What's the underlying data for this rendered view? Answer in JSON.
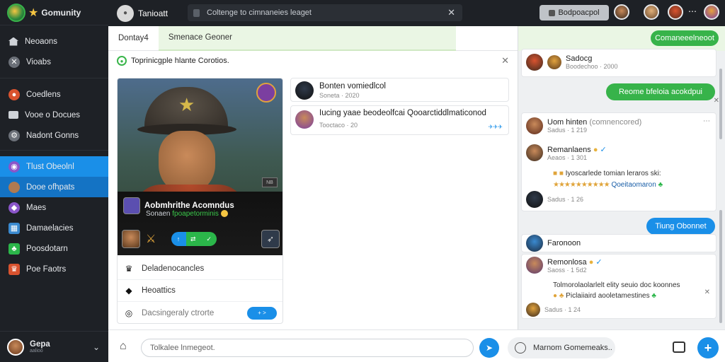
{
  "sidebar": {
    "brand": "Gomunity",
    "nav": [
      {
        "label": "Neoaons",
        "icon": "home-icon",
        "color": "#888888"
      },
      {
        "label": "Vioabs",
        "icon": "game-icon",
        "color": "#888888"
      }
    ],
    "nav2": [
      {
        "label": "Coedlens",
        "icon": "fire-icon",
        "color": "#d9532f"
      },
      {
        "label": "Vooe o Docues",
        "icon": "video-icon",
        "color": "#888888"
      },
      {
        "label": "Nadont Gonns",
        "icon": "gear-icon",
        "color": "#888888"
      }
    ],
    "nav3": [
      {
        "label": "Tlust Obeolnl",
        "icon": "orb-icon",
        "color": "#8a55c9",
        "state": "active"
      },
      {
        "label": "Dooe ofhpats",
        "icon": "avatar-icon",
        "color": "#b07a50",
        "state": "active2"
      },
      {
        "label": "Maes",
        "icon": "shield-icon",
        "color": "#8a55c9"
      },
      {
        "label": "Damaelacies",
        "icon": "puzzle-icon",
        "color": "#3a8ad0"
      },
      {
        "label": "Poosdotarn",
        "icon": "plant-icon",
        "color": "#2bb64a"
      },
      {
        "label": "Poe Faotrs",
        "icon": "trophy-icon",
        "color": "#d9532f"
      }
    ],
    "user": {
      "name": "Gepa",
      "sub": "aalioo"
    }
  },
  "topbar": {
    "title": "Tanioatt",
    "search_placeholder": "Coltenge to cimnaneies leaget",
    "pill_label": "Bodpoacpol",
    "colors": {
      "accent": "#1a8fe8",
      "green": "#37b34a"
    }
  },
  "main": {
    "tabs": [
      "Dontay4",
      "Smenace Geoner"
    ],
    "subheader": "Toprinicgple hlante Corotios.",
    "card": {
      "title": "Aobmhrithe Acomndus",
      "sub_prefix": "Sonaen",
      "sub_green": "fpoapetorminis",
      "mini_badge": "NB",
      "list": [
        {
          "label": "Deladenocancles",
          "icon": "crown-icon"
        },
        {
          "label": "Heoattics",
          "icon": "diamond-icon"
        },
        {
          "label": "Dacsingeraly ctrorte",
          "icon": "target-icon",
          "toggle": "+ >"
        }
      ]
    },
    "posts": [
      {
        "name": "Bonten vomiedlcol",
        "time": "Soneta · 2020"
      },
      {
        "name": "Iucing yaae beodeolfcai Qooarctiddlmaticonod",
        "time": "Tooctaco · 20"
      }
    ]
  },
  "composer": {
    "placeholder": "Tolkalee lnmegeot.",
    "mention": "Marnom Gomemeaks.."
  },
  "rightcol": {
    "top_button": "Comaneeelneoot",
    "entries": [
      {
        "name": "Sadocg",
        "time": "Boodechoo · 2000"
      },
      {
        "name": "Uom hinten",
        "extra": "(comnencored)",
        "time": "Sadus · 1 219"
      },
      {
        "name": "Remanlaens",
        "time": "Aeaos · 1 301",
        "line1": "Iyoscarlede tomian leraros ski:",
        "line2": "Qoeitaomaron",
        "time2": "Sadus · 1 26"
      },
      {
        "name": "Faronoon"
      },
      {
        "name": "Remonlosa",
        "time": "Saoss · 1 5d2",
        "line1": "Tolmorolaolarlelt elity seuio doc koonnes",
        "line2": "Piclaiiaird aooletamestines",
        "time2": "Sadus · 1 24"
      }
    ],
    "bubble1": "Reome bfeloia acokdpui",
    "bubble2": "Tiung Obonnet"
  }
}
